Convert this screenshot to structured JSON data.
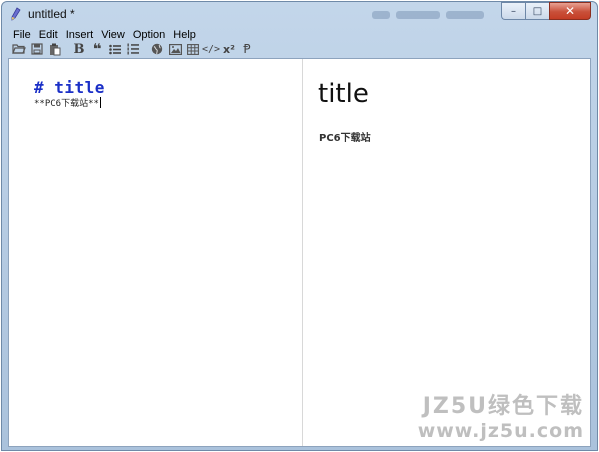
{
  "window": {
    "title": "untitled *",
    "controls": {
      "minimize": "–",
      "maximize": "□",
      "close": "✕"
    }
  },
  "menubar": {
    "items": [
      {
        "label": "File"
      },
      {
        "label": "Edit"
      },
      {
        "label": "Insert"
      },
      {
        "label": "View"
      },
      {
        "label": "Option"
      },
      {
        "label": "Help"
      }
    ]
  },
  "toolbar": {
    "bold_label": "B",
    "quote_label": "❝",
    "code_label": "</>",
    "superscript_label": "x²",
    "strike_label": "Ᵽ"
  },
  "editor": {
    "heading_line": "# title",
    "body_line": "**PC6下载站**"
  },
  "preview": {
    "heading": "title",
    "paragraph": "PC6下载站"
  },
  "watermark": {
    "top": "JZ5U绿色下载",
    "bottom": "www.jz5u.com"
  }
}
